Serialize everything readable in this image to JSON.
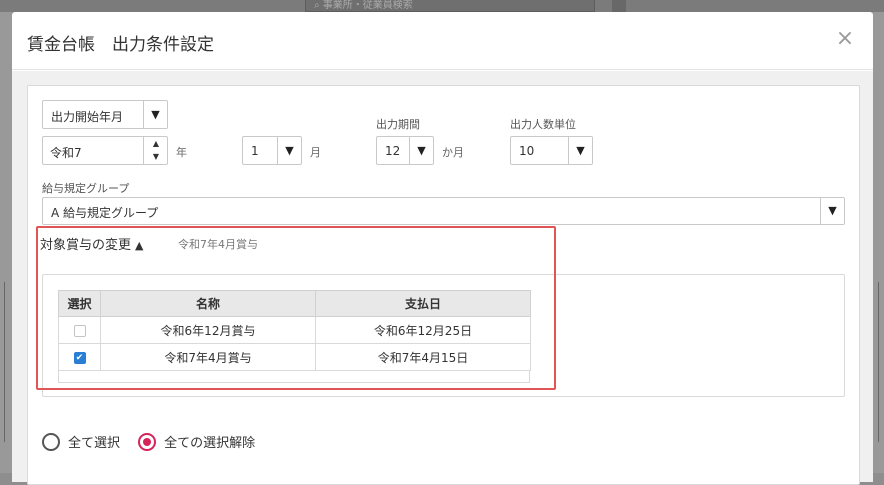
{
  "background": {
    "search_placeholder": "事業所・従業員検索"
  },
  "dialog": {
    "title": "賃金台帳　出力条件設定",
    "close_symbol": "×"
  },
  "form": {
    "start_month_select": "出力開始年月",
    "year_value": "令和7",
    "year_unit": "年",
    "month_value": "1",
    "month_unit": "月",
    "period_label": "出力期間",
    "period_value": "12",
    "period_unit": "か月",
    "people_unit_label": "出力人数単位",
    "people_unit_value": "10",
    "rule_group_label": "給与規定グループ",
    "rule_group_value": "A 給与規定グループ"
  },
  "bonus_section": {
    "title": "対象賞与の変更",
    "current_selection": "令和7年4月賞与",
    "columns": [
      "選択",
      "名称",
      "支払日"
    ],
    "rows": [
      {
        "name": "令和6年12月賞与",
        "pay_date": "令和6年12月25日",
        "checked": false
      },
      {
        "name": "令和7年4月賞与",
        "pay_date": "令和7年4月15日",
        "checked": true
      }
    ]
  },
  "selection_mode": {
    "select_all": "全て選択",
    "deselect_all": "全ての選択解除",
    "selected": "deselect_all"
  },
  "colors": {
    "accent_radio": "#d6245b",
    "checkbox_checked": "#2a7fd4",
    "highlight_border": "#e05555"
  }
}
